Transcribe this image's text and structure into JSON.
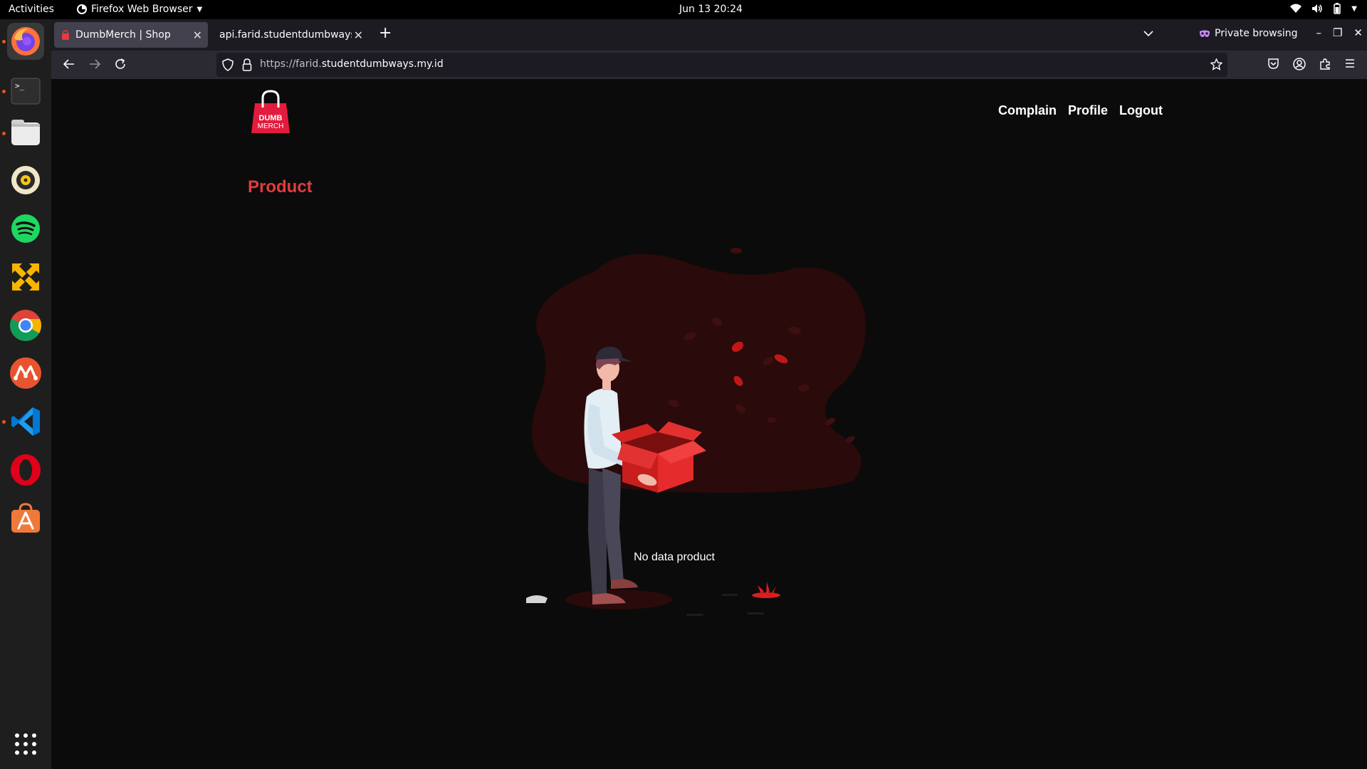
{
  "system": {
    "activities_label": "Activities",
    "app_menu_label": "Firefox Web Browser",
    "clock": "Jun 13  20:24"
  },
  "dock": {
    "apps": [
      "firefox-icon",
      "terminal-icon",
      "files-icon",
      "rhythmbox-icon",
      "spotify-icon",
      "network-tool-icon",
      "chrome-icon",
      "mendeley-icon",
      "vscode-icon",
      "opera-icon",
      "app-store-icon"
    ],
    "show_apps": "show-applications-icon"
  },
  "browser": {
    "tabs": [
      {
        "title": "DumbMerch | Shop",
        "active": true
      },
      {
        "title": "api.farid.studentdumbways.",
        "active": false
      }
    ],
    "private_label": "Private browsing",
    "url_prefix": "https://farid.",
    "url_domain": "studentdumbways.my.id"
  },
  "site": {
    "logo_text_top": "DUMB",
    "logo_text_bottom": "MERCH",
    "nav": {
      "complain": "Complain",
      "profile": "Profile",
      "logout": "Logout"
    },
    "title": "Product",
    "empty_message": "No data product"
  },
  "colors": {
    "brand_red": "#e23c3c",
    "page_bg": "#0b0b0b",
    "blob": "#2a0a0a"
  }
}
